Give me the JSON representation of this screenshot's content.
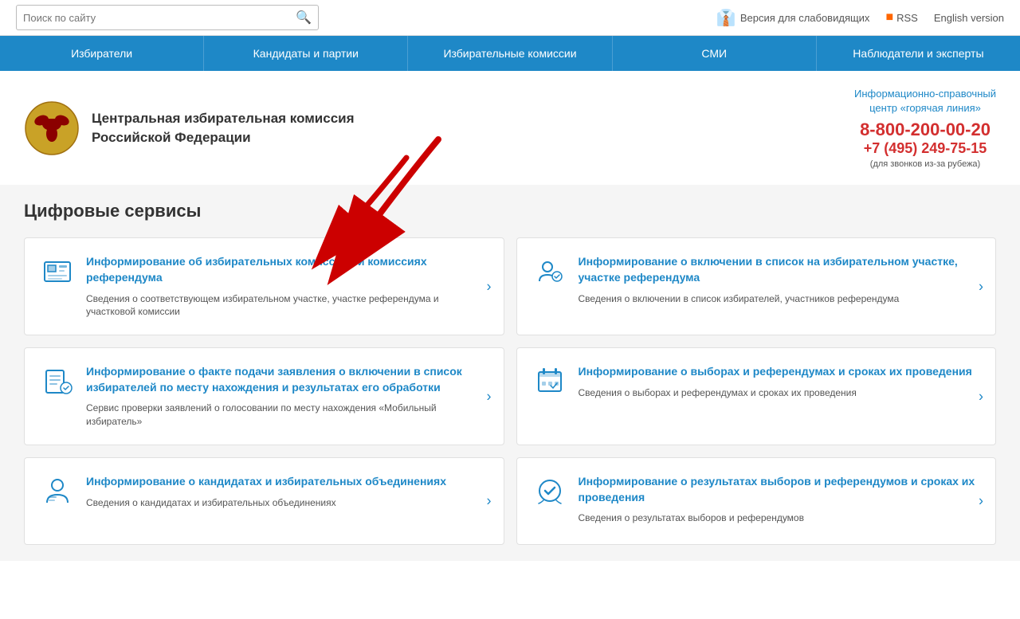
{
  "topbar": {
    "search_placeholder": "Поиск по сайту",
    "visually_impaired": "Версия для слабовидящих",
    "rss": "RSS",
    "english": "English version"
  },
  "nav": {
    "items": [
      {
        "label": "Избиратели"
      },
      {
        "label": "Кандидаты и партии"
      },
      {
        "label": "Избирательные комиссии"
      },
      {
        "label": "СМИ"
      },
      {
        "label": "Наблюдатели и эксперты"
      }
    ]
  },
  "header": {
    "org_name_line1": "Центральная избирательная комиссия",
    "org_name_line2": "Российской Федерации",
    "hotline_title_line1": "Информационно-справочный",
    "hotline_title_line2": "центр «горячая линия»",
    "hotline_main": "8-800-200-00-20",
    "hotline_alt": "+7 (495) 249-75-15",
    "hotline_note": "(для звонков из-за рубежа)"
  },
  "main": {
    "section_title": "Цифровые сервисы",
    "cards": [
      {
        "id": "card1",
        "title": "Информирование об избирательных комиссиях и комиссиях референдума",
        "desc": "Сведения о соответствующем избирательном участке, участке референдума и участковой комиссии"
      },
      {
        "id": "card2",
        "title": "Информирование о включении в список на избирательном участке, участке референдума",
        "desc": "Сведения о включении в список избирателей, участников референдума"
      },
      {
        "id": "card3",
        "title": "Информирование о факте подачи заявления о включении в список избирателей по месту нахождения и результатах его обработки",
        "desc": "Сервис проверки заявлений о голосовании по месту нахождения «Мобильный избиратель»"
      },
      {
        "id": "card4",
        "title": "Информирование о выборах и референдумах и сроках их проведения",
        "desc": "Сведения о выборах и референдумах и сроках их проведения"
      },
      {
        "id": "card5",
        "title": "Информирование о кандидатах и избирательных объединениях",
        "desc": "Сведения о кандидатах и избирательных объединениях"
      },
      {
        "id": "card6",
        "title": "Информирование о результатах выборов и референдумов и сроках их проведения",
        "desc": "Сведения о результатах выборов и референдумов"
      }
    ]
  }
}
